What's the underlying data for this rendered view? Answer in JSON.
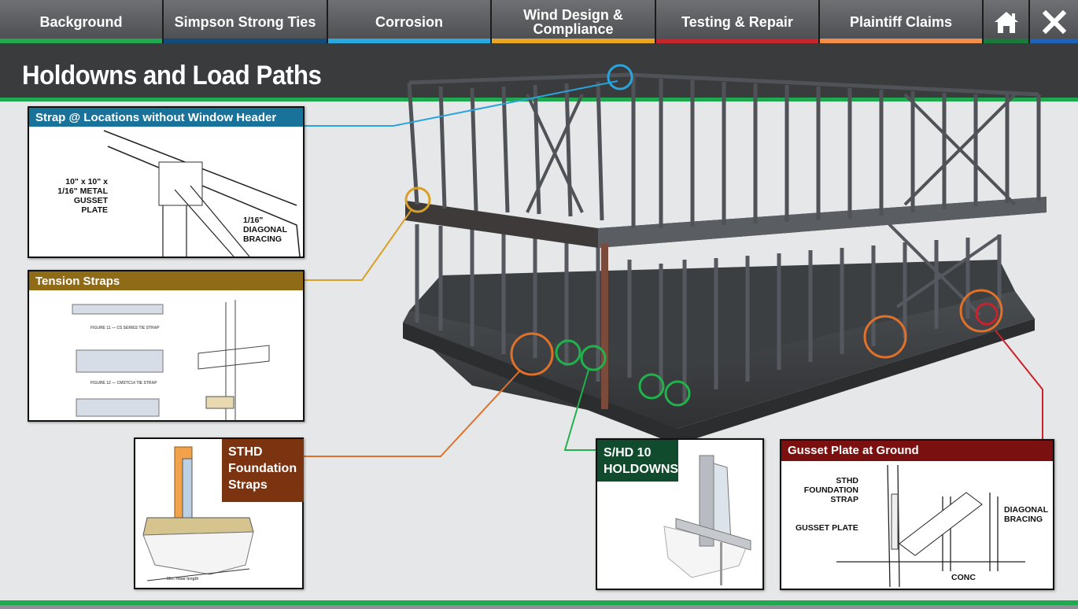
{
  "nav": {
    "tabs": [
      {
        "label": "Background",
        "color": "#21a84f"
      },
      {
        "label": "Simpson Strong Ties",
        "color": "#134b7a"
      },
      {
        "label": "Corrosion",
        "color": "#2aa9e0"
      },
      {
        "label": "Wind Design & Compliance",
        "color": "#e9a623"
      },
      {
        "label": "Testing & Repair",
        "color": "#c4262e"
      },
      {
        "label": "Plaintiff Claims",
        "color": "#f08e4a"
      }
    ],
    "home_icon": "home-icon",
    "home_color": "#1a7a3c",
    "close_icon": "close-icon",
    "close_color": "#1e63b8"
  },
  "page": {
    "title": "Holdowns and Load Paths"
  },
  "callouts": {
    "strap": {
      "title": "Strap @ Locations without Window Header",
      "color": "#19729a",
      "labels": [
        "10\" x 10\" x",
        "1/16\" METAL",
        "GUSSET PLATE",
        "1/16\"",
        "DIAGONAL",
        "BRACING"
      ]
    },
    "tension": {
      "title": "Tension Straps",
      "color": "#8f6a17",
      "figures": [
        "FIGURE 11 — CS SERIES TIE STRAP",
        "FIGURE 12 — CMSTC14 TIE STRAP"
      ]
    },
    "sthd": {
      "title_lines": [
        "STHD",
        "Foundation",
        "Straps"
      ],
      "color": "#7c3410",
      "labels": [
        "Min. rebar length"
      ]
    },
    "shd": {
      "title_lines": [
        "S/HD 10",
        "HOLDOWNS"
      ],
      "color": "#0f4b2c"
    },
    "gusset": {
      "title": "Gusset Plate at Ground",
      "color": "#7a1010",
      "labels": [
        "STHD",
        "FOUNDATION",
        "STRAP",
        "GUSSET PLATE",
        "DIAGONAL",
        "BRACING",
        "CONC"
      ]
    }
  },
  "markers": {
    "blue": "#2ba3db",
    "gold": "#d9a027",
    "orange": "#e0712b",
    "green": "#21b24b",
    "red": "#c8232c"
  }
}
